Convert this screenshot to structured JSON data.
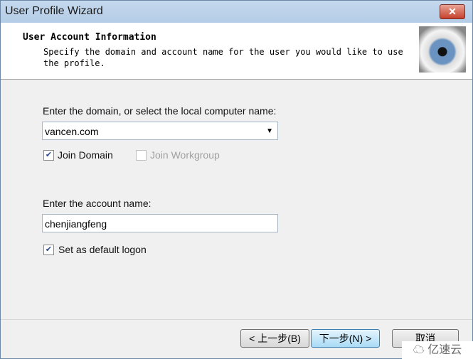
{
  "window": {
    "title": "User Profile Wizard",
    "close_icon": "close-icon"
  },
  "header": {
    "title": "User Account Information",
    "description": "Specify the domain and account name for the user you would like to use the profile.",
    "image": "eye-image"
  },
  "domain": {
    "label": "Enter the domain, or select the local computer name:",
    "value": "vancen.com"
  },
  "join_domain": {
    "label": "Join Domain",
    "checked": true
  },
  "join_workgroup": {
    "label": "Join Workgroup",
    "checked": false,
    "enabled": false
  },
  "account": {
    "label": "Enter the account name:",
    "value": "chenjiangfeng"
  },
  "default_logon": {
    "label": "Set as default logon",
    "checked": true
  },
  "buttons": {
    "back": "< 上一步(B)",
    "next": "下一步(N) >",
    "cancel": "取消"
  },
  "watermark": "亿速云"
}
